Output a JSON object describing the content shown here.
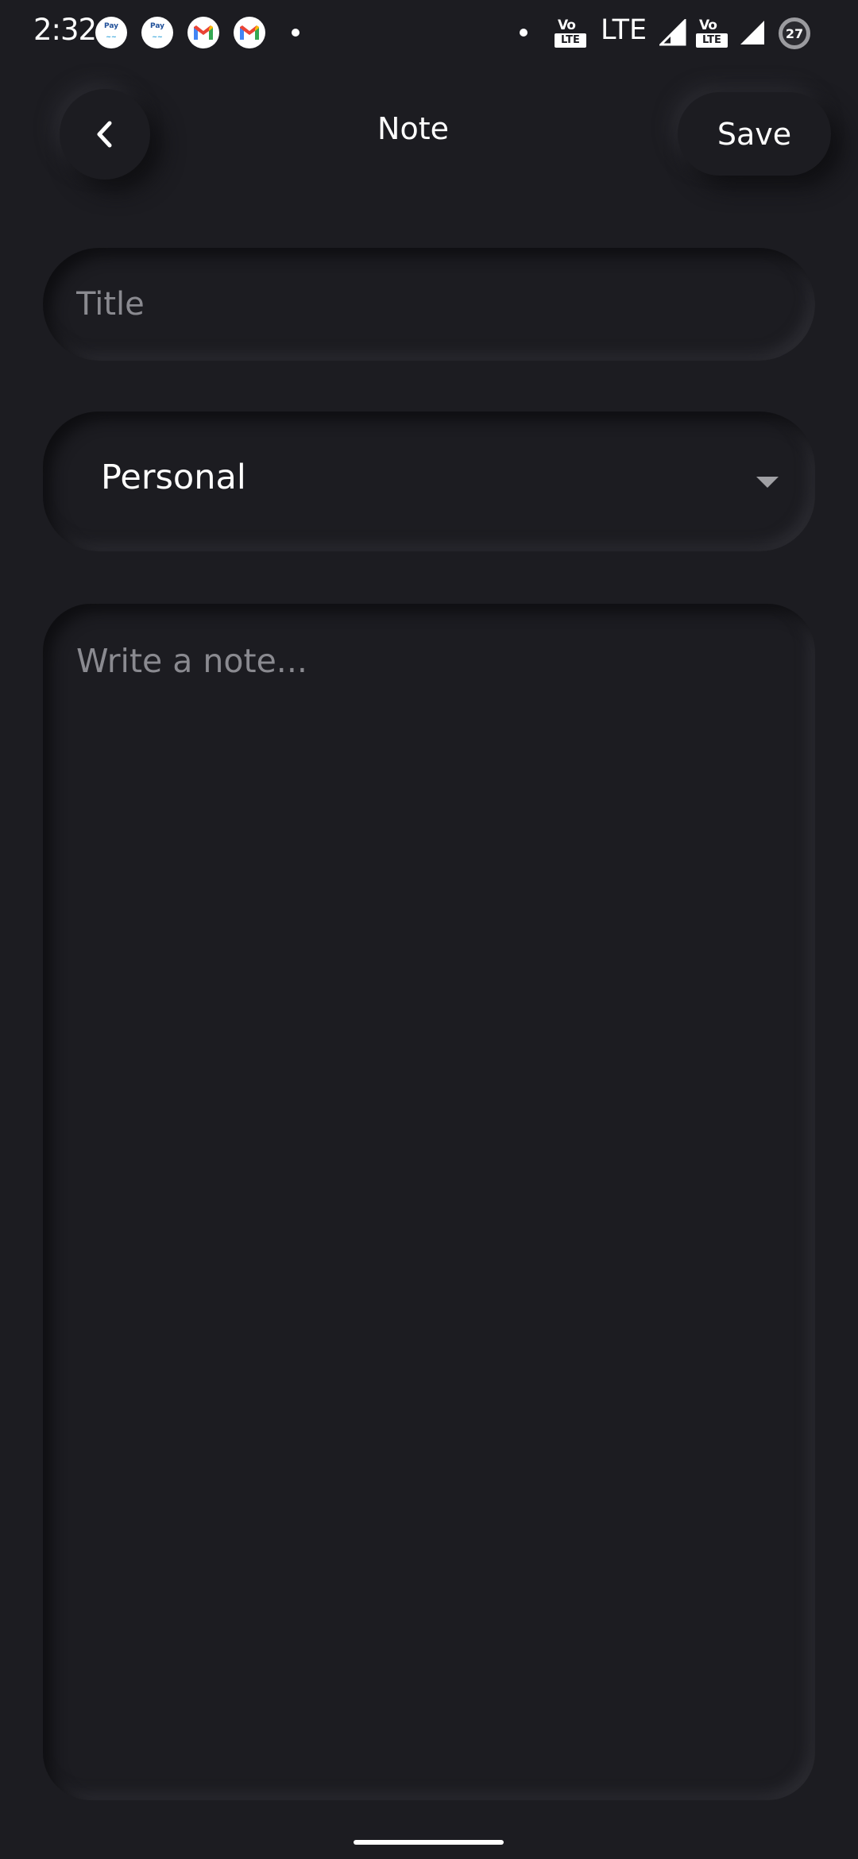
{
  "status_bar": {
    "time": "2:32",
    "network_label": "LTE",
    "volte_top": "Vo",
    "volte_bottom": "LTE",
    "battery_level": "27",
    "notification_icons": [
      "paytm-icon",
      "paytm-icon",
      "gmail-icon",
      "gmail-icon"
    ]
  },
  "header": {
    "title": "Note",
    "save_label": "Save"
  },
  "form": {
    "title_placeholder": "Title",
    "category_selected": "Personal",
    "note_placeholder": "Write a note..."
  },
  "colors": {
    "background": "#1c1c21",
    "text": "#ffffff",
    "placeholder": "#8a8a90"
  }
}
